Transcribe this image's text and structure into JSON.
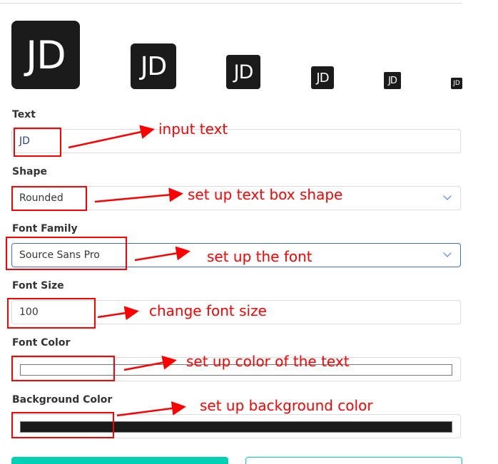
{
  "avatar_text": "JD",
  "colors": {
    "avatar_bg": "#1b1b1b",
    "avatar_fg": "#ffffff",
    "annotation": "#ff0000",
    "primary": "#00d1b2",
    "focus": "#3e6fd8"
  },
  "fields": {
    "text": {
      "label": "Text",
      "value": "JD"
    },
    "shape": {
      "label": "Shape",
      "value": "Rounded"
    },
    "font_family": {
      "label": "Font Family",
      "value": "Source Sans Pro"
    },
    "font_size": {
      "label": "Font Size",
      "value": "100"
    },
    "font_color": {
      "label": "Font Color",
      "value": "#ffffff"
    },
    "background_color": {
      "label": "Background Color",
      "value": "#1b1b1b"
    }
  },
  "annotations": [
    "input text",
    "set up text box shape",
    "set up the font",
    "change font size",
    "set up color of the text",
    "set up background color"
  ]
}
